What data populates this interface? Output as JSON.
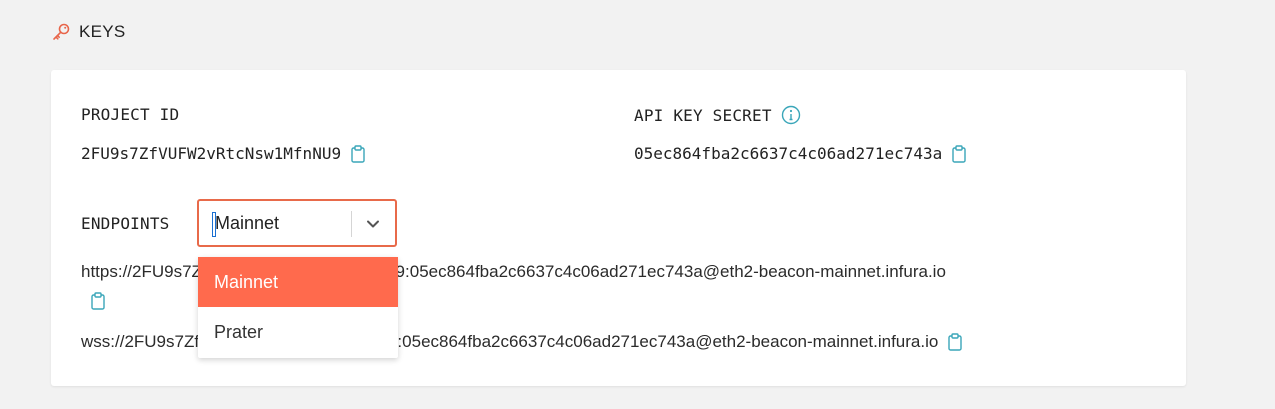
{
  "section": {
    "title": "KEYS",
    "icon": "key-icon"
  },
  "project_id": {
    "label": "PROJECT ID",
    "value": "2FU9s7ZfVUFW2vRtcNsw1MfnNU9",
    "copy_icon": "clipboard-icon"
  },
  "api_key_secret": {
    "label": "API KEY SECRET",
    "info_icon": "info-icon",
    "value": "05ec864fba2c6637c4c06ad271ec743a",
    "copy_icon": "clipboard-icon"
  },
  "endpoints": {
    "label": "ENDPOINTS",
    "selected": "Mainnet",
    "options": [
      "Mainnet",
      "Prater"
    ],
    "https_url": "https://2FU9s7ZfVUFW2vRtcNsw1MfnNU9:05ec864fba2c6637c4c06ad271ec743a@eth2-beacon-mainnet.infura.io",
    "wss_url": "wss://2FU9s7ZfVUFW2vRtcNsw1MfnNU9:05ec864fba2c6637c4c06ad271ec743a@eth2-beacon-mainnet.infura.io"
  },
  "colors": {
    "accent": "#ff6a4d",
    "border_focus": "#e86a4a",
    "icon_teal": "#3aa6b9"
  }
}
